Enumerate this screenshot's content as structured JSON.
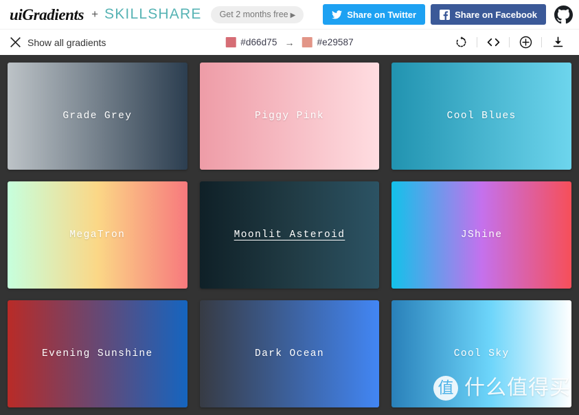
{
  "header": {
    "logo": "uiGradients",
    "plus": "+",
    "partner": "SKILLSHARE",
    "promo_label": "Get 2 months free",
    "promo_caret": "▶",
    "twitter_label": "Share on Twitter",
    "facebook_label": "Share on Facebook",
    "twitter_color": "#1da1f2",
    "facebook_color": "#3b5998",
    "github_icon": "github-icon"
  },
  "toolbar": {
    "close_icon": "close-x-icon",
    "show_all_label": "Show all gradients",
    "color_start": "#d66d75",
    "color_end": "#e29587",
    "color_start_swatch": "#d66d75",
    "color_end_swatch": "#e29587",
    "arrow": "→",
    "icons": [
      {
        "name": "refresh-icon",
        "title": "Randomize"
      },
      {
        "name": "code-icon",
        "title": "Get CSS"
      },
      {
        "name": "plus-circle-icon",
        "title": "Add gradient"
      },
      {
        "name": "download-icon",
        "title": "Download"
      }
    ]
  },
  "grid": {
    "cards": [
      {
        "name": "Grade Grey",
        "css": "linear-gradient(to right, #bdc3c7 0%, #2c3e50 100%)",
        "hovered": false
      },
      {
        "name": "Piggy Pink",
        "css": "linear-gradient(to right, #ee9ca7 0%, #ffdde1 100%)",
        "hovered": false
      },
      {
        "name": "Cool Blues",
        "css": "linear-gradient(to right, #2193b0 0%, #6dd5ed 100%)",
        "hovered": false
      },
      {
        "name": "MegaTron",
        "css": "linear-gradient(to right, #c6ffdd 0%, #fbd786 50%, #f7797d 100%)",
        "hovered": false
      },
      {
        "name": "Moonlit Asteroid",
        "css": "linear-gradient(to right, #0f2027 0%, #203a43 50%, #2c5364 100%)",
        "hovered": true
      },
      {
        "name": "JShine",
        "css": "linear-gradient(to right, #12c2e9 0%, #c471ed 50%, #f64f59 100%)",
        "hovered": false
      },
      {
        "name": "Evening Sunshine",
        "css": "linear-gradient(to right, #b92b27 0%, #1565c0 100%)",
        "hovered": false
      },
      {
        "name": "Dark Ocean",
        "css": "linear-gradient(to right, #373b44 0%, #4286f4 100%)",
        "hovered": false
      },
      {
        "name": "Cool Sky",
        "css": "linear-gradient(to right, #2980b9 0%, #6dd5fa 55%, #ffffff 100%)",
        "hovered": false
      }
    ]
  },
  "watermark": {
    "badge": "值",
    "text": "什么值得买"
  }
}
